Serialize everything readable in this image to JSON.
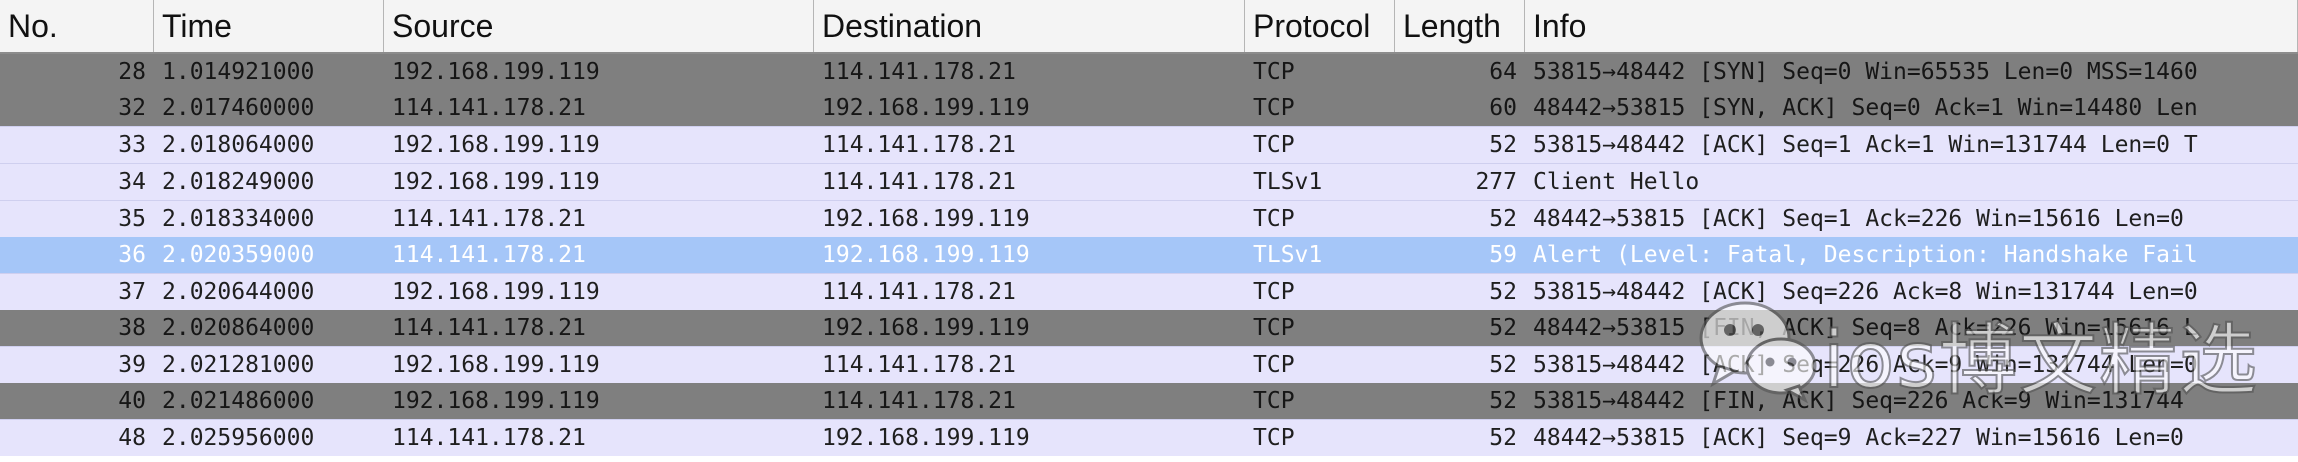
{
  "columns": [
    {
      "key": "no",
      "label": "No."
    },
    {
      "key": "time",
      "label": "Time"
    },
    {
      "key": "source",
      "label": "Source"
    },
    {
      "key": "destination",
      "label": "Destination"
    },
    {
      "key": "protocol",
      "label": "Protocol"
    },
    {
      "key": "length",
      "label": "Length"
    },
    {
      "key": "info",
      "label": "Info"
    }
  ],
  "rows": [
    {
      "no": "28",
      "time": "1.014921000",
      "source": "192.168.199.119",
      "destination": "114.141.178.21",
      "protocol": "TCP",
      "length": "64",
      "info": "53815→48442 [SYN] Seq=0 Win=65535 Len=0 MSS=1460",
      "style": "dark"
    },
    {
      "no": "32",
      "time": "2.017460000",
      "source": "114.141.178.21",
      "destination": "192.168.199.119",
      "protocol": "TCP",
      "length": "60",
      "info": "48442→53815 [SYN, ACK] Seq=0 Ack=1 Win=14480 Len",
      "style": "dark"
    },
    {
      "no": "33",
      "time": "2.018064000",
      "source": "192.168.199.119",
      "destination": "114.141.178.21",
      "protocol": "TCP",
      "length": "52",
      "info": "53815→48442 [ACK] Seq=1 Ack=1 Win=131744 Len=0 T",
      "style": "light"
    },
    {
      "no": "34",
      "time": "2.018249000",
      "source": "192.168.199.119",
      "destination": "114.141.178.21",
      "protocol": "TLSv1",
      "length": "277",
      "info": "Client Hello",
      "style": "light"
    },
    {
      "no": "35",
      "time": "2.018334000",
      "source": "114.141.178.21",
      "destination": "192.168.199.119",
      "protocol": "TCP",
      "length": "52",
      "info": "48442→53815 [ACK] Seq=1 Ack=226 Win=15616 Len=0",
      "style": "light"
    },
    {
      "no": "36",
      "time": "2.020359000",
      "source": "114.141.178.21",
      "destination": "192.168.199.119",
      "protocol": "TLSv1",
      "length": "59",
      "info": "Alert (Level: Fatal, Description: Handshake Fail",
      "style": "sel"
    },
    {
      "no": "37",
      "time": "2.020644000",
      "source": "192.168.199.119",
      "destination": "114.141.178.21",
      "protocol": "TCP",
      "length": "52",
      "info": "53815→48442 [ACK] Seq=226 Ack=8 Win=131744 Len=0",
      "style": "light"
    },
    {
      "no": "38",
      "time": "2.020864000",
      "source": "114.141.178.21",
      "destination": "192.168.199.119",
      "protocol": "TCP",
      "length": "52",
      "info": "48442→53815 [FIN, ACK] Seq=8 Ack=226 Win=15616 L",
      "style": "dark"
    },
    {
      "no": "39",
      "time": "2.021281000",
      "source": "192.168.199.119",
      "destination": "114.141.178.21",
      "protocol": "TCP",
      "length": "52",
      "info": "53815→48442 [ACK] Seq=226 Ack=9 Win=131744 Len=0",
      "style": "light"
    },
    {
      "no": "40",
      "time": "2.021486000",
      "source": "192.168.199.119",
      "destination": "114.141.178.21",
      "protocol": "TCP",
      "length": "52",
      "info": "53815→48442 [FIN, ACK] Seq=226 Ack=9 Win=131744",
      "style": "dark"
    },
    {
      "no": "48",
      "time": "2.025956000",
      "source": "114.141.178.21",
      "destination": "192.168.199.119",
      "protocol": "TCP",
      "length": "52",
      "info": "48442→53815 [ACK] Seq=9 Ack=227 Win=15616 Len=0",
      "style": "light"
    }
  ],
  "watermark": {
    "text": "ios博文精选",
    "icon": "wechat-logo-icon"
  },
  "colors": {
    "dark_row": "#7f7f7f",
    "light_row": "#e6e4fc",
    "selected_row": "#a5c6f8"
  }
}
